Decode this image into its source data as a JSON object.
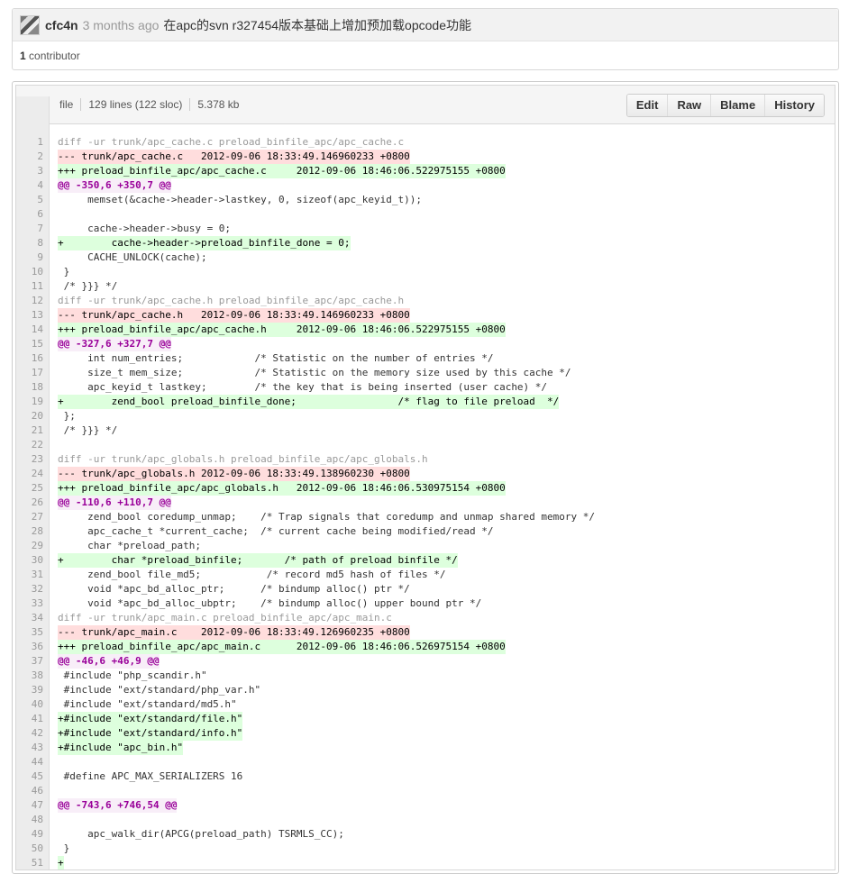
{
  "commit": {
    "author": "cfc4n",
    "time_ago": "3 months ago",
    "message": "在apc的svn r327454版本基础上增加预加载opcode功能",
    "contributors_count": "1",
    "contributors_label": "contributor"
  },
  "file": {
    "mode": "file",
    "lines_info": "129 lines (122 sloc)",
    "size": "5.378 kb",
    "buttons": [
      "Edit",
      "Raw",
      "Blame",
      "History"
    ]
  },
  "code_lines": [
    {
      "n": "1",
      "t": "diff -ur trunk/apc_cache.c preload_binfile_apc/apc_cache.c",
      "k": "hdr"
    },
    {
      "n": "2",
      "t": "--- trunk/apc_cache.c   2012-09-06 18:33:49.146960233 +0800",
      "k": "del"
    },
    {
      "n": "3",
      "t": "+++ preload_binfile_apc/apc_cache.c     2012-09-06 18:46:06.522975155 +0800",
      "k": "add"
    },
    {
      "n": "4",
      "t": "@@ -350,6 +350,7 @@",
      "k": "hunk"
    },
    {
      "n": "5",
      "t": "     memset(&cache->header->lastkey, 0, sizeof(apc_keyid_t));",
      "k": "ctx"
    },
    {
      "n": "6",
      "t": "",
      "k": "ctx"
    },
    {
      "n": "7",
      "t": "     cache->header->busy = 0;",
      "k": "ctx"
    },
    {
      "n": "8",
      "t": "+        cache->header->preload_binfile_done = 0;",
      "k": "add"
    },
    {
      "n": "9",
      "t": "     CACHE_UNLOCK(cache);",
      "k": "ctx"
    },
    {
      "n": "10",
      "t": " }",
      "k": "ctx"
    },
    {
      "n": "11",
      "t": " /* }}} */",
      "k": "ctx"
    },
    {
      "n": "12",
      "t": "diff -ur trunk/apc_cache.h preload_binfile_apc/apc_cache.h",
      "k": "hdr"
    },
    {
      "n": "13",
      "t": "--- trunk/apc_cache.h   2012-09-06 18:33:49.146960233 +0800",
      "k": "del"
    },
    {
      "n": "14",
      "t": "+++ preload_binfile_apc/apc_cache.h     2012-09-06 18:46:06.522975155 +0800",
      "k": "add"
    },
    {
      "n": "15",
      "t": "@@ -327,6 +327,7 @@",
      "k": "hunk"
    },
    {
      "n": "16",
      "t": "     int num_entries;            /* Statistic on the number of entries */",
      "k": "ctx"
    },
    {
      "n": "17",
      "t": "     size_t mem_size;            /* Statistic on the memory size used by this cache */",
      "k": "ctx"
    },
    {
      "n": "18",
      "t": "     apc_keyid_t lastkey;        /* the key that is being inserted (user cache) */",
      "k": "ctx"
    },
    {
      "n": "19",
      "t": "+        zend_bool preload_binfile_done;                 /* flag to file preload  */",
      "k": "add"
    },
    {
      "n": "20",
      "t": " };",
      "k": "ctx"
    },
    {
      "n": "21",
      "t": " /* }}} */",
      "k": "ctx"
    },
    {
      "n": "22",
      "t": "",
      "k": "ctx"
    },
    {
      "n": "23",
      "t": "diff -ur trunk/apc_globals.h preload_binfile_apc/apc_globals.h",
      "k": "hdr"
    },
    {
      "n": "24",
      "t": "--- trunk/apc_globals.h 2012-09-06 18:33:49.138960230 +0800",
      "k": "del"
    },
    {
      "n": "25",
      "t": "+++ preload_binfile_apc/apc_globals.h   2012-09-06 18:46:06.530975154 +0800",
      "k": "add"
    },
    {
      "n": "26",
      "t": "@@ -110,6 +110,7 @@",
      "k": "hunk"
    },
    {
      "n": "27",
      "t": "     zend_bool coredump_unmap;    /* Trap signals that coredump and unmap shared memory */",
      "k": "ctx"
    },
    {
      "n": "28",
      "t": "     apc_cache_t *current_cache;  /* current cache being modified/read */",
      "k": "ctx"
    },
    {
      "n": "29",
      "t": "     char *preload_path;",
      "k": "ctx"
    },
    {
      "n": "30",
      "t": "+        char *preload_binfile;       /* path of preload binfile */",
      "k": "add"
    },
    {
      "n": "31",
      "t": "     zend_bool file_md5;           /* record md5 hash of files */",
      "k": "ctx"
    },
    {
      "n": "32",
      "t": "     void *apc_bd_alloc_ptr;      /* bindump alloc() ptr */",
      "k": "ctx"
    },
    {
      "n": "33",
      "t": "     void *apc_bd_alloc_ubptr;    /* bindump alloc() upper bound ptr */",
      "k": "ctx"
    },
    {
      "n": "34",
      "t": "diff -ur trunk/apc_main.c preload_binfile_apc/apc_main.c",
      "k": "hdr"
    },
    {
      "n": "35",
      "t": "--- trunk/apc_main.c    2012-09-06 18:33:49.126960235 +0800",
      "k": "del"
    },
    {
      "n": "36",
      "t": "+++ preload_binfile_apc/apc_main.c      2012-09-06 18:46:06.526975154 +0800",
      "k": "add"
    },
    {
      "n": "37",
      "t": "@@ -46,6 +46,9 @@",
      "k": "hunk"
    },
    {
      "n": "38",
      "t": " #include \"php_scandir.h\"",
      "k": "ctx"
    },
    {
      "n": "39",
      "t": " #include \"ext/standard/php_var.h\"",
      "k": "ctx"
    },
    {
      "n": "40",
      "t": " #include \"ext/standard/md5.h\"",
      "k": "ctx"
    },
    {
      "n": "41",
      "t": "+#include \"ext/standard/file.h\"",
      "k": "add"
    },
    {
      "n": "42",
      "t": "+#include \"ext/standard/info.h\"",
      "k": "add"
    },
    {
      "n": "43",
      "t": "+#include \"apc_bin.h\"",
      "k": "add"
    },
    {
      "n": "44",
      "t": "",
      "k": "ctx"
    },
    {
      "n": "45",
      "t": " #define APC_MAX_SERIALIZERS 16",
      "k": "ctx"
    },
    {
      "n": "46",
      "t": "",
      "k": "ctx"
    },
    {
      "n": "47",
      "t": "@@ -743,6 +746,54 @@",
      "k": "hunk"
    },
    {
      "n": "48",
      "t": "",
      "k": "ctx"
    },
    {
      "n": "49",
      "t": "     apc_walk_dir(APCG(preload_path) TSRMLS_CC);",
      "k": "ctx"
    },
    {
      "n": "50",
      "t": " }",
      "k": "ctx"
    },
    {
      "n": "51",
      "t": "+",
      "k": "add"
    }
  ]
}
